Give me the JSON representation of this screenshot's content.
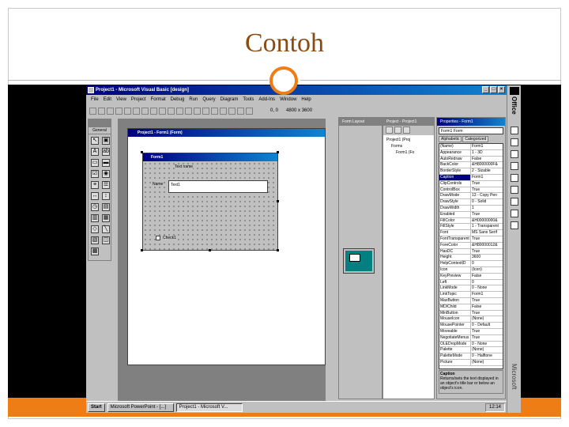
{
  "slide": {
    "title": "Contoh",
    "accent_color": "#ee7d16"
  },
  "app": {
    "window_title": "Project1 - Microsoft Visual Basic [design]",
    "menu": [
      "File",
      "Edit",
      "View",
      "Project",
      "Format",
      "Debug",
      "Run",
      "Query",
      "Diagram",
      "Tools",
      "Add-Ins",
      "Window",
      "Help"
    ],
    "coord_left": "0, 0",
    "coord_size": "4800 x 3600"
  },
  "toolbox": {
    "label": "General"
  },
  "project_window": {
    "title": "Project1 - Form1 (Form)"
  },
  "form1": {
    "title": "Form1",
    "top_label": "Text name",
    "name_label": "Name",
    "text_value": "Text1",
    "checkbox_label": "Check1"
  },
  "form_layout": {
    "title": "Form Layout"
  },
  "project_explorer": {
    "title": "Project - Project1",
    "tree": [
      "Project1 (Proj",
      "Forms",
      "Form1 (Fo"
    ]
  },
  "properties": {
    "title": "Properties - Form1",
    "object": "Form1 Form",
    "tabs": [
      "Alphabetic",
      "Categorized"
    ],
    "rows": [
      {
        "k": "(Name)",
        "v": "Form1"
      },
      {
        "k": "Appearance",
        "v": "1 - 3D"
      },
      {
        "k": "AutoRedraw",
        "v": "False"
      },
      {
        "k": "BackColor",
        "v": "&H8000000F&"
      },
      {
        "k": "BorderStyle",
        "v": "2 - Sizable"
      },
      {
        "k": "Caption",
        "v": "Form1"
      },
      {
        "k": "ClipControls",
        "v": "True"
      },
      {
        "k": "ControlBox",
        "v": "True"
      },
      {
        "k": "DrawMode",
        "v": "13 - Copy Pen"
      },
      {
        "k": "DrawStyle",
        "v": "0 - Solid"
      },
      {
        "k": "DrawWidth",
        "v": "1"
      },
      {
        "k": "Enabled",
        "v": "True"
      },
      {
        "k": "FillColor",
        "v": "&H00000000&"
      },
      {
        "k": "FillStyle",
        "v": "1 - Transparent"
      },
      {
        "k": "Font",
        "v": "MS Sans Serif"
      },
      {
        "k": "FontTransparent",
        "v": "True"
      },
      {
        "k": "ForeColor",
        "v": "&H80000012&"
      },
      {
        "k": "HasDC",
        "v": "True"
      },
      {
        "k": "Height",
        "v": "3600"
      },
      {
        "k": "HelpContextID",
        "v": "0"
      },
      {
        "k": "Icon",
        "v": "(Icon)"
      },
      {
        "k": "KeyPreview",
        "v": "False"
      },
      {
        "k": "Left",
        "v": "0"
      },
      {
        "k": "LinkMode",
        "v": "0 - None"
      },
      {
        "k": "LinkTopic",
        "v": "Form1"
      },
      {
        "k": "MaxButton",
        "v": "True"
      },
      {
        "k": "MDIChild",
        "v": "False"
      },
      {
        "k": "MinButton",
        "v": "True"
      },
      {
        "k": "MouseIcon",
        "v": "(None)"
      },
      {
        "k": "MousePointer",
        "v": "0 - Default"
      },
      {
        "k": "Moveable",
        "v": "True"
      },
      {
        "k": "NegotiateMenus",
        "v": "True"
      },
      {
        "k": "OLEDropMode",
        "v": "0 - None"
      },
      {
        "k": "Palette",
        "v": "(None)"
      },
      {
        "k": "PaletteMode",
        "v": "0 - Halftone"
      },
      {
        "k": "Picture",
        "v": "(None)"
      }
    ],
    "selected_index": 5,
    "desc_title": "Caption",
    "desc_text": "Returns/sets the text displayed in an object's title bar or below an object's icon."
  },
  "taskbar": {
    "start": "Start",
    "tasks": [
      "Microsoft PowerPoint - [...]",
      "Project1 - Microsoft V..."
    ],
    "clock": "12:14"
  },
  "office": {
    "label": "Office",
    "vendor": "Microsoft"
  }
}
